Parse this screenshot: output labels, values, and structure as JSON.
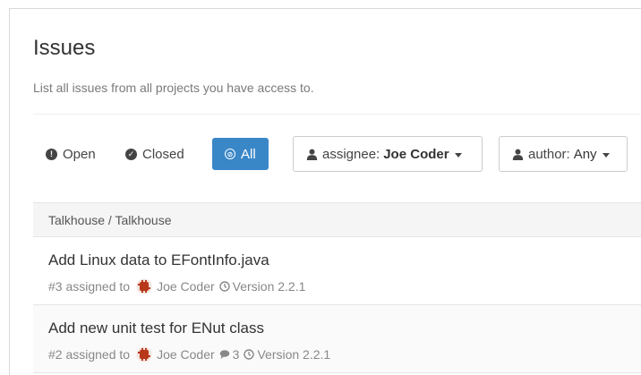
{
  "page": {
    "title": "Issues",
    "subtitle": "List all issues from all projects you have access to."
  },
  "filters": {
    "states": [
      {
        "label": "Open",
        "icon": "exclamation-circle-icon",
        "active": false
      },
      {
        "label": "Closed",
        "icon": "check-circle-icon",
        "active": false
      },
      {
        "label": "All",
        "icon": "ban-circle-icon",
        "active": true
      }
    ],
    "assignee": {
      "label": "assignee:",
      "value": "Joe Coder"
    },
    "author": {
      "label": "author:",
      "value": "Any"
    }
  },
  "list": {
    "group_header": "Talkhouse / Talkhouse",
    "issues": [
      {
        "title": "Add Linux data to EFontInfo.java",
        "number_prefix": "#3 assigned to",
        "assignee": "Joe Coder",
        "comments": "",
        "milestone": "Version 2.2.1"
      },
      {
        "title": "Add new unit test for ENut class",
        "number_prefix": "#2 assigned to",
        "assignee": "Joe Coder",
        "comments": "3",
        "milestone": "Version 2.2.1"
      }
    ]
  },
  "colors": {
    "accent": "#3a87c8",
    "muted_text": "#888888",
    "header_bg": "#f5f5f5"
  }
}
